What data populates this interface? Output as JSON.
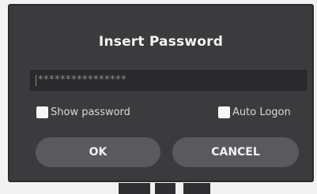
{
  "dialog": {
    "title": "Insert Password",
    "password_field": {
      "masked_value": "****************"
    },
    "checkboxes": [
      {
        "label": "Show password",
        "checked": false
      },
      {
        "label": "Auto Logon",
        "checked": false
      }
    ],
    "buttons": {
      "ok_label": "OK",
      "cancel_label": "CANCEL"
    }
  },
  "colors": {
    "dialog_background": "#3b3b3e",
    "input_background": "#2a2a2c",
    "button_background": "#5a5a5e",
    "text": "#f4f4f4"
  }
}
